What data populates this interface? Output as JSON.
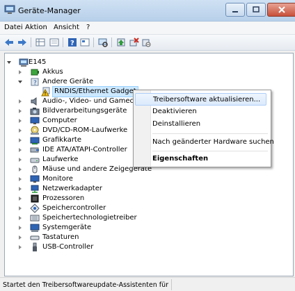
{
  "window": {
    "title": "Geräte-Manager"
  },
  "menu": [
    "Datei",
    "Aktion",
    "Ansicht",
    "?"
  ],
  "toolbar": {
    "icons": [
      "back-arrow-icon",
      "forward-arrow-icon",
      "grid-view-icon",
      "properties-sheet-icon",
      "help-icon",
      "view-icon",
      "scan-hardware-icon",
      "update-driver-icon",
      "uninstall-icon",
      "disable-icon"
    ]
  },
  "tree": {
    "root": "E145",
    "items": [
      "Akkus",
      "Andere Geräte",
      "RNDIS/Ethernet Gadget",
      "Audio-, Video- und Gamec",
      "Bildverarbeitungsgeräte",
      "Computer",
      "DVD/CD-ROM-Laufwerke",
      "Grafikkarte",
      "IDE ATA/ATAPI-Controller",
      "Laufwerke",
      "Mäuse und andere Zeigegeräte",
      "Monitore",
      "Netzwerkadapter",
      "Prozessoren",
      "Speichercontroller",
      "Speichertechnologietreiber",
      "Systemgeräte",
      "Tastaturen",
      "USB-Controller"
    ]
  },
  "context_menu": {
    "items": [
      "Treibersoftware aktualisieren...",
      "Deaktivieren",
      "Deinstallieren",
      "Nach geänderter Hardware suchen",
      "Eigenschaften"
    ]
  },
  "status": {
    "text": "Startet den Treibersoftwareupdate-Assistenten für"
  }
}
